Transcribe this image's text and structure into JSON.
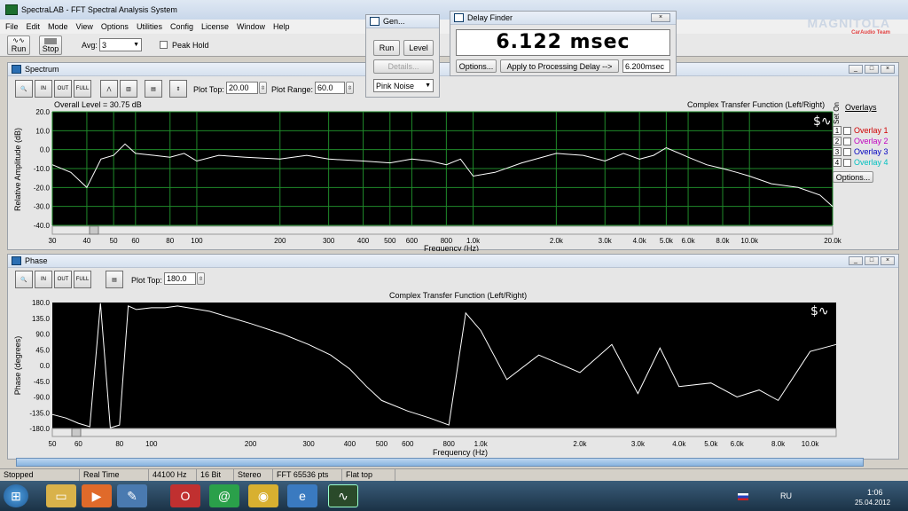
{
  "app": {
    "title": "SpectraLAB - FFT Spectral Analysis System",
    "menu": [
      "File",
      "Edit",
      "Mode",
      "View",
      "Options",
      "Utilities",
      "Config",
      "License",
      "Window",
      "Help"
    ],
    "brand": "MAGNITOLA",
    "brand_sub": "CarAudio Team"
  },
  "toolbar": {
    "run_label": "Run",
    "stop_label": "Stop",
    "avg_label": "Avg:",
    "avg_value": "3",
    "peak_hold_label": "Peak Hold"
  },
  "generator": {
    "title": "Gen...",
    "run_label": "Run",
    "level_label": "Level",
    "details_label": "Details...",
    "signal": "Pink Noise"
  },
  "delay_finder": {
    "title": "Delay Finder",
    "value": "6.122 msec",
    "options_label": "Options...",
    "apply_label": "Apply to Processing Delay -->",
    "applied_value": "6.200msec"
  },
  "spectrum": {
    "title": "Spectrum",
    "plot_top_label": "Plot Top:",
    "plot_top_value": "20.00",
    "plot_range_label": "Plot Range:",
    "plot_range_value": "60.0",
    "overall_level": "Overall Level = 30.75 dB",
    "function_label": "Complex Transfer Function (Left/Right)",
    "ylabel": "Relative Amplitude (dB)",
    "y_ticks": [
      "20.0",
      "10.0",
      "0.0",
      "-10.0",
      "-20.0",
      "-30.0",
      "-40.0"
    ],
    "x_ticks": [
      "30",
      "40",
      "50",
      "60",
      "80",
      "100",
      "200",
      "300",
      "400",
      "500",
      "600",
      "800",
      "1.0k",
      "2.0k",
      "3.0k",
      "4.0k",
      "5.0k",
      "6.0k",
      "8.0k",
      "10.0k",
      "20.0k"
    ],
    "xlabel_partial": "Frequency (Hz)",
    "overlays": {
      "header": "Overlays",
      "set_label": "Set",
      "on_label": "On",
      "items": [
        {
          "num": "1",
          "label": "Overlay 1",
          "color": "#d00000"
        },
        {
          "num": "2",
          "label": "Overlay 2",
          "color": "#c000c0"
        },
        {
          "num": "3",
          "label": "Overlay 3",
          "color": "#0000c0"
        },
        {
          "num": "4",
          "label": "Overlay 4",
          "color": "#00c0c0"
        }
      ],
      "options_label": "Options..."
    }
  },
  "phase": {
    "title": "Phase",
    "plot_top_label": "Plot Top:",
    "plot_top_value": "180.0",
    "function_label": "Complex Transfer Function (Left/Right)",
    "ylabel": "Phase (degrees)",
    "y_ticks": [
      "180.0",
      "135.0",
      "90.0",
      "45.0",
      "0.0",
      "-45.0",
      "-90.0",
      "-135.0",
      "-180.0"
    ],
    "x_ticks": [
      "50",
      "60",
      "80",
      "100",
      "200",
      "300",
      "400",
      "500",
      "600",
      "800",
      "1.0k",
      "2.0k",
      "3.0k",
      "4.0k",
      "5.0k",
      "6.0k",
      "8.0k",
      "10.0k"
    ],
    "xlabel": "Frequency (Hz)"
  },
  "status": [
    "Stopped",
    "Real Time",
    "44100 Hz",
    "16 Bit",
    "Stereo",
    "FFT 65536 pts",
    "Flat top"
  ],
  "taskbar": {
    "lang": "RU",
    "time": "1:06",
    "date": "25.04.2012"
  },
  "colors": {
    "grid": "#1f8a2a",
    "trace": "#ffffff",
    "plot_bg": "#000000"
  },
  "chart_data": [
    {
      "type": "line",
      "title": "Complex Transfer Function (Left/Right)",
      "ylabel": "Relative Amplitude (dB)",
      "xlabel": "Frequency (Hz)",
      "xscale": "log",
      "xlim": [
        30,
        20000
      ],
      "ylim": [
        -40,
        20
      ],
      "grid": true,
      "x": [
        30,
        35,
        40,
        45,
        50,
        55,
        60,
        70,
        80,
        90,
        100,
        120,
        150,
        200,
        250,
        300,
        400,
        500,
        600,
        700,
        800,
        900,
        1000,
        1200,
        1500,
        2000,
        2500,
        3000,
        3500,
        4000,
        4500,
        5000,
        6000,
        7000,
        8000,
        9000,
        10000,
        12000,
        15000,
        18000,
        20000
      ],
      "series": [
        {
          "values": [
            -8,
            -12,
            -20,
            -5,
            -3,
            3,
            -2,
            -3,
            -4,
            -2,
            -6,
            -3,
            -4,
            -5,
            -3,
            -5,
            -6,
            -7,
            -5,
            -6,
            -8,
            -5,
            -14,
            -12,
            -7,
            -2,
            -3,
            -6,
            -2,
            -5,
            -3,
            1,
            -4,
            -8,
            -10,
            -12,
            -14,
            -18,
            -20,
            -24,
            -30
          ]
        }
      ]
    },
    {
      "type": "line",
      "title": "Complex Transfer Function (Left/Right)",
      "ylabel": "Phase (degrees)",
      "xlabel": "Frequency (Hz)",
      "xscale": "log",
      "xlim": [
        50,
        12000
      ],
      "ylim": [
        -180,
        180
      ],
      "grid": false,
      "x": [
        50,
        55,
        60,
        65,
        70,
        75,
        80,
        85,
        90,
        100,
        110,
        120,
        150,
        200,
        250,
        300,
        350,
        400,
        450,
        500,
        600,
        700,
        800,
        900,
        1000,
        1200,
        1500,
        2000,
        2500,
        3000,
        3500,
        4000,
        5000,
        6000,
        7000,
        8000,
        10000,
        12000
      ],
      "series": [
        {
          "values": [
            -140,
            -150,
            -165,
            -175,
            178,
            -178,
            -170,
            170,
            160,
            165,
            165,
            170,
            155,
            120,
            90,
            60,
            30,
            -10,
            -60,
            -100,
            -130,
            -150,
            -170,
            150,
            100,
            -40,
            30,
            -20,
            60,
            -80,
            50,
            -60,
            -50,
            -90,
            -70,
            -100,
            40,
            60
          ]
        }
      ]
    }
  ]
}
